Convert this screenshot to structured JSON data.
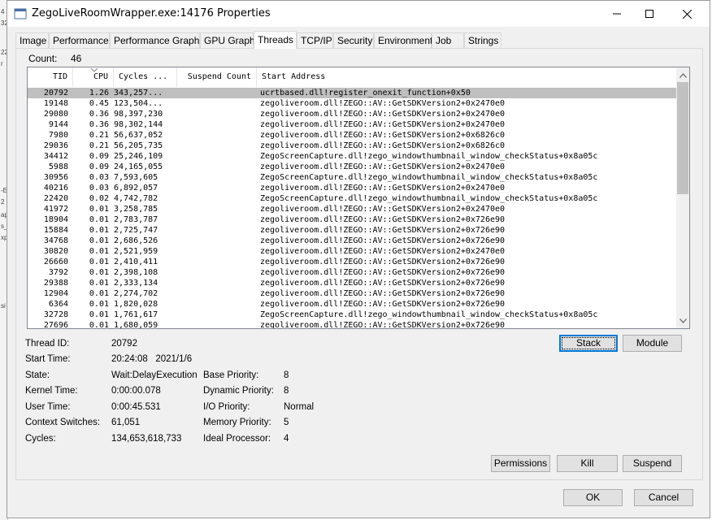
{
  "window": {
    "title": "ZegoLiveRoomWrapper.exe:14176 Properties",
    "minimize": "—",
    "maximize": "□",
    "close": "✕"
  },
  "tabs": [
    "Image",
    "Performance",
    "Performance Graph",
    "GPU Graph",
    "Threads",
    "TCP/IP",
    "Security",
    "Environment",
    "Job",
    "Strings"
  ],
  "active_tab": "Threads",
  "count": {
    "label": "Count:",
    "value": "46"
  },
  "threads": {
    "columns": {
      "tid": "TID",
      "cpu": "CPU",
      "cycles": "Cycles ...",
      "suspend": "Suspend Count",
      "address": "Start Address"
    },
    "rows": [
      {
        "tid": "20792",
        "cpu": "1.26",
        "cycles": "343,257...",
        "suspend": "",
        "address": "ucrtbased.dll!register_onexit_function+0x50"
      },
      {
        "tid": "19148",
        "cpu": "0.45",
        "cycles": "123,504...",
        "suspend": "",
        "address": "zegoliveroom.dll!ZEGO::AV::GetSDKVersion2+0x2470e0"
      },
      {
        "tid": "29080",
        "cpu": "0.36",
        "cycles": "98,397,230",
        "suspend": "",
        "address": "zegoliveroom.dll!ZEGO::AV::GetSDKVersion2+0x2470e0"
      },
      {
        "tid": "9144",
        "cpu": "0.36",
        "cycles": "98,302,144",
        "suspend": "",
        "address": "zegoliveroom.dll!ZEGO::AV::GetSDKVersion2+0x2470e0"
      },
      {
        "tid": "7980",
        "cpu": "0.21",
        "cycles": "56,637,052",
        "suspend": "",
        "address": "zegoliveroom.dll!ZEGO::AV::GetSDKVersion2+0x6826c0"
      },
      {
        "tid": "29036",
        "cpu": "0.21",
        "cycles": "56,205,735",
        "suspend": "",
        "address": "zegoliveroom.dll!ZEGO::AV::GetSDKVersion2+0x6826c0"
      },
      {
        "tid": "34412",
        "cpu": "0.09",
        "cycles": "25,246,109",
        "suspend": "",
        "address": "ZegoScreenCapture.dll!zego_windowthumbnail_window_checkStatus+0x8a05c"
      },
      {
        "tid": "5988",
        "cpu": "0.09",
        "cycles": "24,165,055",
        "suspend": "",
        "address": "zegoliveroom.dll!ZEGO::AV::GetSDKVersion2+0x2470e0"
      },
      {
        "tid": "30956",
        "cpu": "0.03",
        "cycles": "7,593,605",
        "suspend": "",
        "address": "ZegoScreenCapture.dll!zego_windowthumbnail_window_checkStatus+0x8a05c"
      },
      {
        "tid": "40216",
        "cpu": "0.03",
        "cycles": "6,892,057",
        "suspend": "",
        "address": "zegoliveroom.dll!ZEGO::AV::GetSDKVersion2+0x2470e0"
      },
      {
        "tid": "22420",
        "cpu": "0.02",
        "cycles": "4,742,782",
        "suspend": "",
        "address": "ZegoScreenCapture.dll!zego_windowthumbnail_window_checkStatus+0x8a05c"
      },
      {
        "tid": "41972",
        "cpu": "0.01",
        "cycles": "3,258,785",
        "suspend": "",
        "address": "zegoliveroom.dll!ZEGO::AV::GetSDKVersion2+0x2470e0"
      },
      {
        "tid": "18904",
        "cpu": "0.01",
        "cycles": "2,783,787",
        "suspend": "",
        "address": "zegoliveroom.dll!ZEGO::AV::GetSDKVersion2+0x726e90"
      },
      {
        "tid": "15884",
        "cpu": "0.01",
        "cycles": "2,725,747",
        "suspend": "",
        "address": "zegoliveroom.dll!ZEGO::AV::GetSDKVersion2+0x726e90"
      },
      {
        "tid": "34768",
        "cpu": "0.01",
        "cycles": "2,686,526",
        "suspend": "",
        "address": "zegoliveroom.dll!ZEGO::AV::GetSDKVersion2+0x726e90"
      },
      {
        "tid": "30820",
        "cpu": "0.01",
        "cycles": "2,521,959",
        "suspend": "",
        "address": "zegoliveroom.dll!ZEGO::AV::GetSDKVersion2+0x2470e0"
      },
      {
        "tid": "26660",
        "cpu": "0.01",
        "cycles": "2,410,411",
        "suspend": "",
        "address": "zegoliveroom.dll!ZEGO::AV::GetSDKVersion2+0x726e90"
      },
      {
        "tid": "3792",
        "cpu": "0.01",
        "cycles": "2,398,108",
        "suspend": "",
        "address": "zegoliveroom.dll!ZEGO::AV::GetSDKVersion2+0x726e90"
      },
      {
        "tid": "29388",
        "cpu": "0.01",
        "cycles": "2,333,134",
        "suspend": "",
        "address": "zegoliveroom.dll!ZEGO::AV::GetSDKVersion2+0x726e90"
      },
      {
        "tid": "12904",
        "cpu": "0.01",
        "cycles": "2,274,702",
        "suspend": "",
        "address": "zegoliveroom.dll!ZEGO::AV::GetSDKVersion2+0x726e90"
      },
      {
        "tid": "6364",
        "cpu": "0.01",
        "cycles": "1,820,028",
        "suspend": "",
        "address": "zegoliveroom.dll!ZEGO::AV::GetSDKVersion2+0x726e90"
      },
      {
        "tid": "32728",
        "cpu": "0.01",
        "cycles": "1,761,617",
        "suspend": "",
        "address": "ZegoScreenCapture.dll!zego_windowthumbnail_window_checkStatus+0x8a05c"
      },
      {
        "tid": "27696",
        "cpu": "0.01",
        "cycles": "1,680,059",
        "suspend": "",
        "address": "zegoliveroom.dll!ZEGO::AV::GetSDKVersion2+0x726e90"
      }
    ]
  },
  "details": {
    "thread_id_label": "Thread ID:",
    "thread_id": "20792",
    "start_time_label": "Start Time:",
    "start_time": "20:24:08   2021/1/6",
    "state_label": "State:",
    "state": "Wait:DelayExecution",
    "kernel_time_label": "Kernel Time:",
    "kernel_time": "0:00:00.078",
    "user_time_label": "User Time:",
    "user_time": "0:00:45.531",
    "context_switches_label": "Context Switches:",
    "context_switches": "61,051",
    "cycles_label": "Cycles:",
    "cycles": "134,653,618,733",
    "base_priority_label": "Base Priority:",
    "base_priority": "8",
    "dynamic_priority_label": "Dynamic Priority:",
    "dynamic_priority": "8",
    "io_priority_label": "I/O Priority:",
    "io_priority": "Normal",
    "memory_priority_label": "Memory Priority:",
    "memory_priority": "5",
    "ideal_processor_label": "Ideal Processor:",
    "ideal_processor": "4"
  },
  "buttons": {
    "stack": "Stack",
    "module": "Module",
    "permissions": "Permissions",
    "kill": "Kill",
    "suspend": "Suspend",
    "ok": "OK",
    "cancel": "Cancel"
  }
}
